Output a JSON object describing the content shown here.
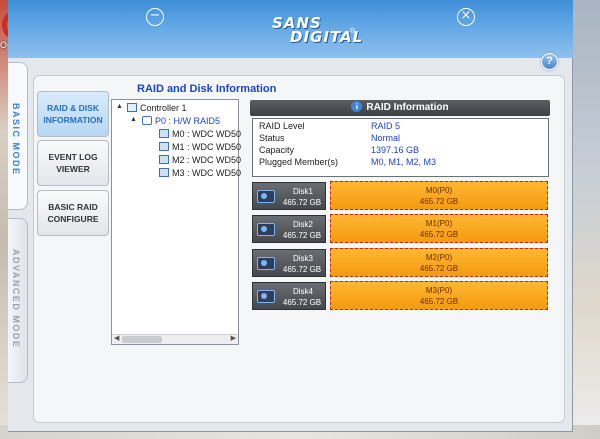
{
  "desktop": {
    "left_icon_label": "Opera"
  },
  "window": {
    "brand_line1": "SANS",
    "brand_line2": "DIGITAL",
    "brand_reg": "®",
    "minimize_symbol": "−",
    "close_symbol": "×",
    "help_symbol": "?"
  },
  "side_tabs": {
    "basic": "BASIC MODE",
    "advanced": "ADVANCED MODE"
  },
  "nav": {
    "raid_disk": "RAID & DISK\nINFORMATION",
    "event_log": "EVENT LOG\nVIEWER",
    "basic_raid": "BASIC RAID\nCONFIGURE"
  },
  "section_title": "RAID and Disk Information",
  "tree": {
    "controller": "Controller 1",
    "raid": "P0 : H/W RAID5",
    "disks": [
      "M0 : WDC WD50",
      "M1 : WDC WD50",
      "M2 : WDC WD50",
      "M3 : WDC WD50"
    ]
  },
  "raid_info": {
    "header": "RAID Information",
    "rows": [
      {
        "label": "RAID Level",
        "value": "RAID 5"
      },
      {
        "label": "Status",
        "value": "Normal"
      },
      {
        "label": "Capacity",
        "value": "1397.16 GB"
      },
      {
        "label": "Plugged Member(s)",
        "value": "M0, M1, M2, M3"
      }
    ]
  },
  "disks": [
    {
      "name": "Disk1",
      "size": "465.72 GB",
      "member": "M0(P0)",
      "member_size": "465.72 GB"
    },
    {
      "name": "Disk2",
      "size": "465.72 GB",
      "member": "M1(P0)",
      "member_size": "465.72 GB"
    },
    {
      "name": "Disk3",
      "size": "465.72 GB",
      "member": "M2(P0)",
      "member_size": "465.72 GB"
    },
    {
      "name": "Disk4",
      "size": "465.72 GB",
      "member": "M3(P0)",
      "member_size": "465.72 GB"
    }
  ],
  "colors": {
    "title_bar": "#4f9ae0",
    "accent_blue": "#1a46c8",
    "member_orange": "#f8a81d",
    "member_border": "#c0261a",
    "info_header": "#474b50"
  }
}
